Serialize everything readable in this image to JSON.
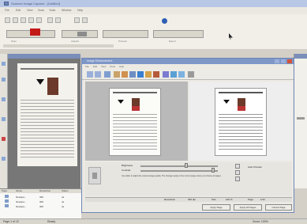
{
  "window": {
    "title": "Scanner Image Capture - [Untitled]"
  },
  "menubar": {
    "items": [
      "File",
      "Edit",
      "View",
      "Scan",
      "Tools",
      "Window",
      "Help"
    ]
  },
  "toolbar": {
    "labels": [
      "Scan",
      "Acquire",
      "Process",
      "Export"
    ]
  },
  "doc_panel": {
    "title": "Document"
  },
  "dialog": {
    "title": "Image Enhancement",
    "menu": [
      "File",
      "Edit",
      "View",
      "Tools",
      "Help"
    ],
    "labels": {
      "brightness": "Brightness",
      "contrast": "Contrast",
      "preview": "Auto Preview"
    },
    "hint": "Use slider to adjust the scanned page quality. The changes apply to the current page unless you choose all pages.",
    "status": [
      "Resolution",
      "300 dpi",
      "Size",
      "100 %",
      "Page",
      "1/12"
    ],
    "buttons": {
      "apply_page": "Apply Page",
      "apply_all": "Apply All Pages",
      "cancel": "Cancel Page"
    }
  },
  "list": {
    "columns": [
      "Page",
      "Name",
      "Resolution",
      "Status"
    ],
    "rows": [
      {
        "icon": "page-icon",
        "name": "Newspa...",
        "res": "300",
        "status": "ok"
      },
      {
        "icon": "page-icon",
        "name": "Newspa...",
        "res": "300",
        "status": "ok"
      },
      {
        "icon": "page-icon",
        "name": "Newspa...",
        "res": "300",
        "status": "ok"
      }
    ]
  },
  "statusbar": {
    "left": "Page 1 of 12",
    "middle": "Ready",
    "right": "Zoom: 100%"
  },
  "colors": {
    "title_bar": "#b8c7e6",
    "dialog_title": "#7f97c7",
    "record": "#c31818"
  }
}
